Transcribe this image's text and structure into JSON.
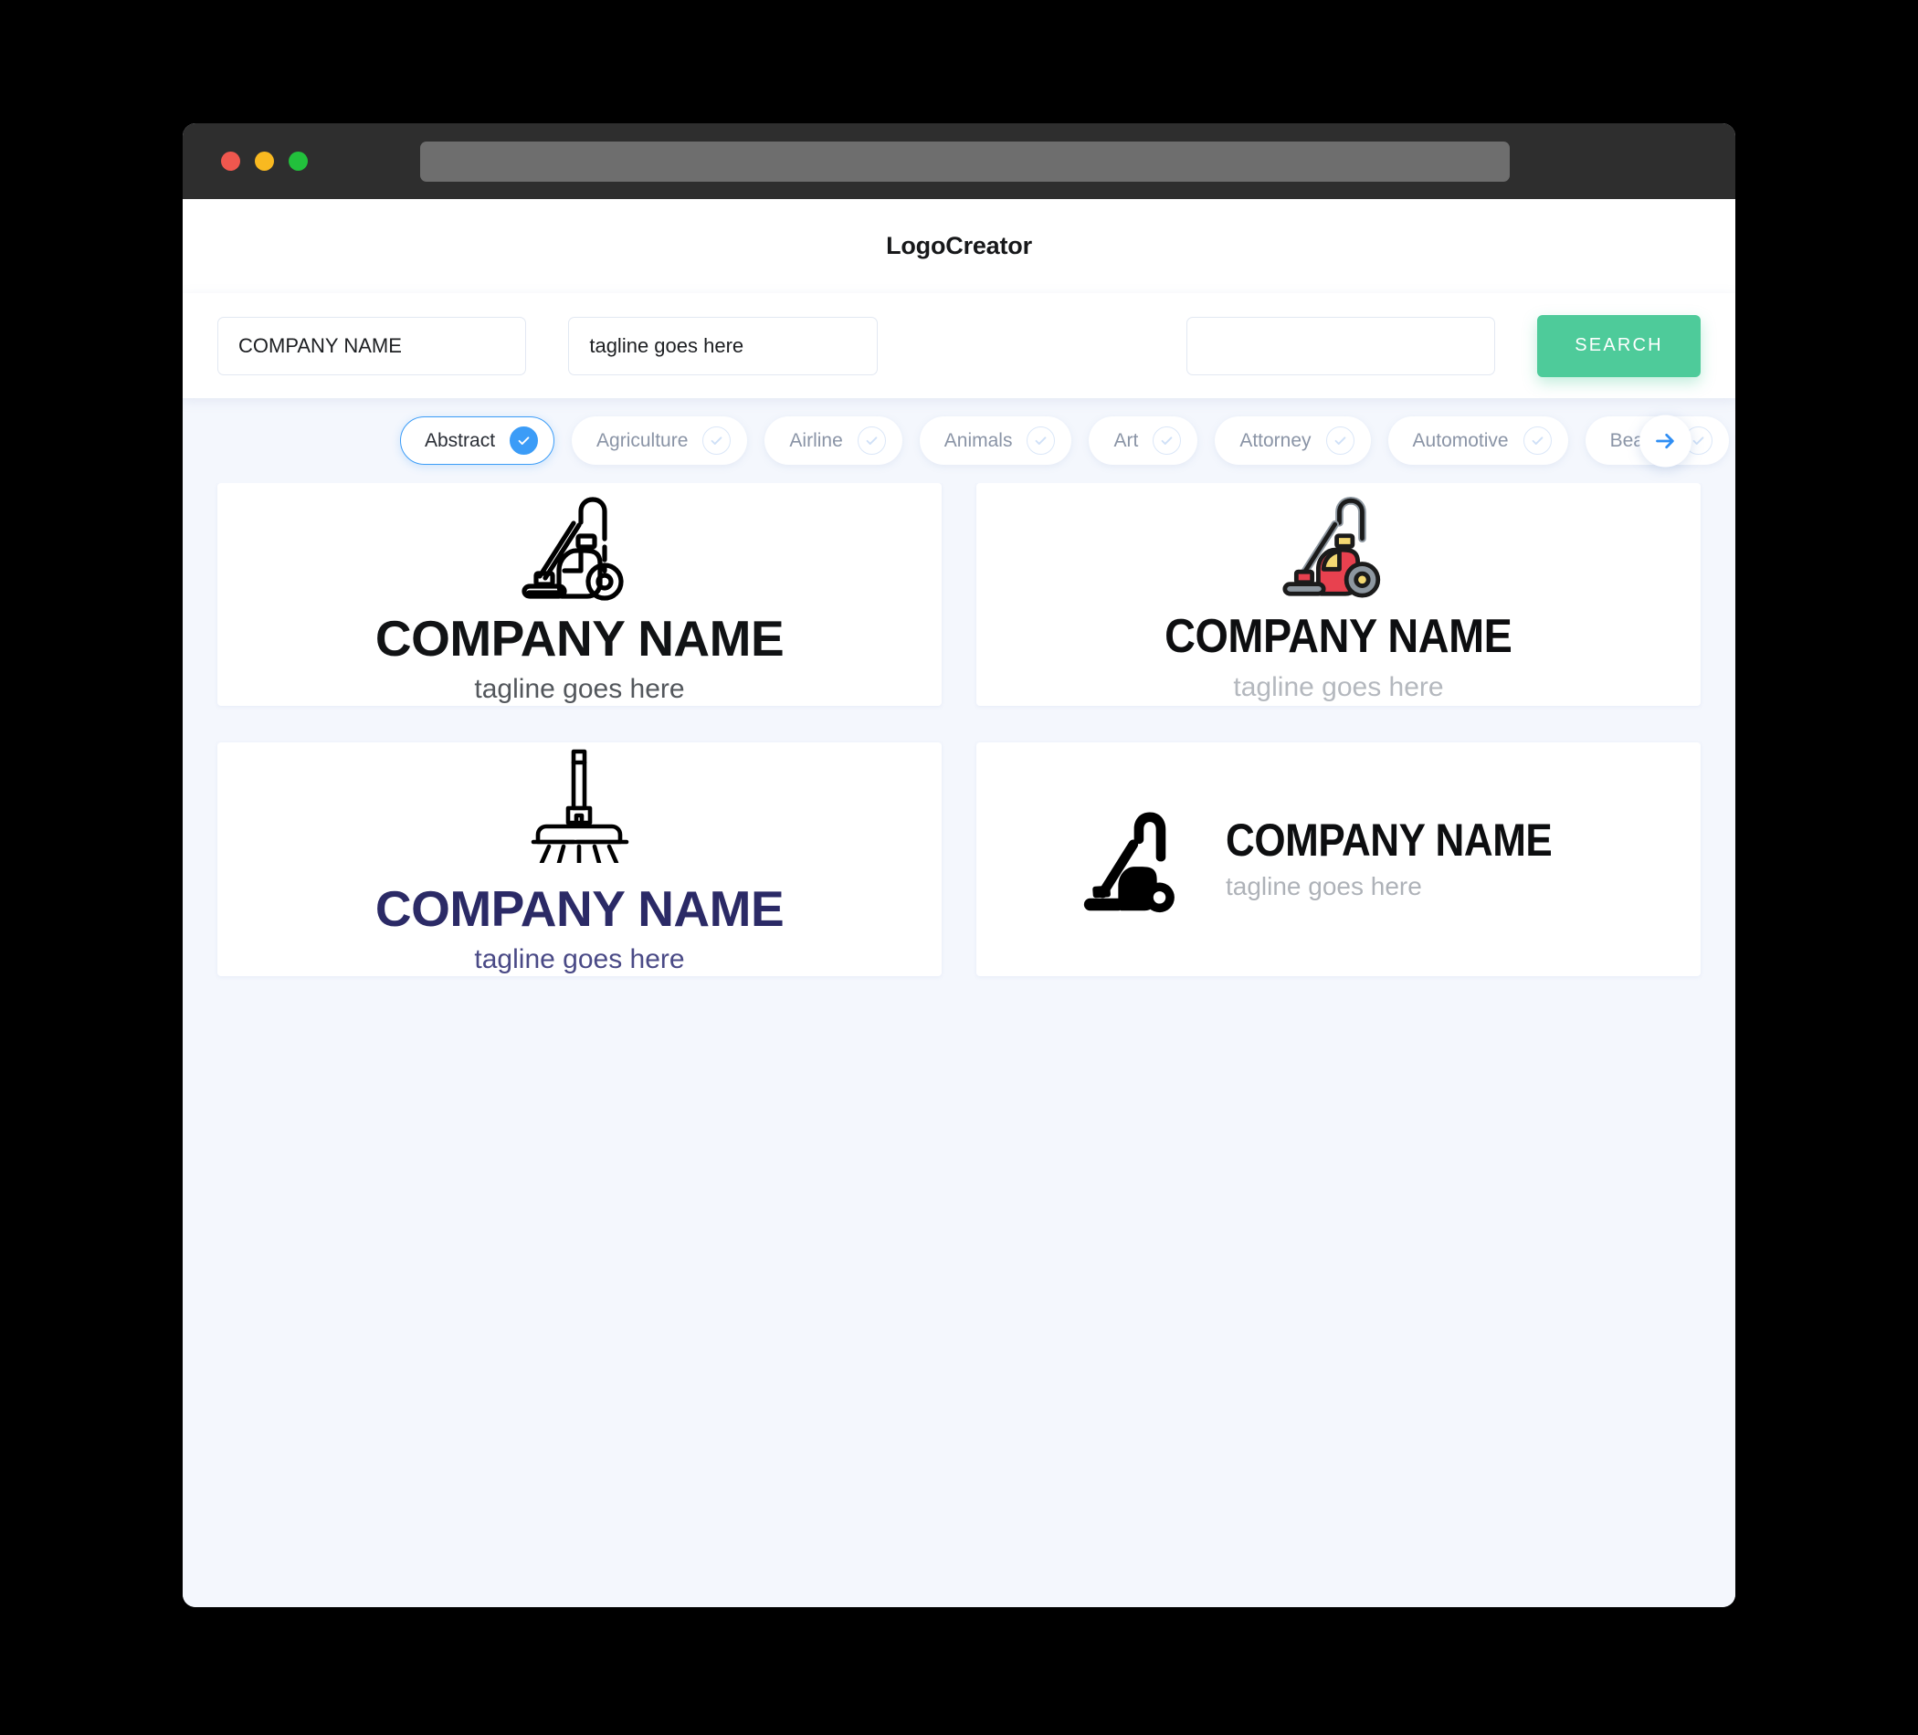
{
  "window": {
    "traffic_lights": [
      "close",
      "minimize",
      "maximize"
    ],
    "colors": {
      "close": "#f0574e",
      "minimize": "#f9b920",
      "maximize": "#22c03c",
      "titlebar": "#2e2e2e",
      "urlbar": "#6e6e6e"
    }
  },
  "header": {
    "title": "LogoCreator"
  },
  "search": {
    "company_value": "COMPANY NAME",
    "company_placeholder": "COMPANY NAME",
    "tagline_value": "tagline goes here",
    "tagline_placeholder": "tagline goes here",
    "keyword_value": "",
    "keyword_placeholder": "",
    "button_label": "SEARCH",
    "button_color": "#4ecb9a"
  },
  "categories": {
    "accent_color": "#3b9cf7",
    "next_icon": "arrow-right-icon",
    "items": [
      {
        "label": "Abstract",
        "selected": true
      },
      {
        "label": "Agriculture",
        "selected": false
      },
      {
        "label": "Airline",
        "selected": false
      },
      {
        "label": "Animals",
        "selected": false
      },
      {
        "label": "Art",
        "selected": false
      },
      {
        "label": "Attorney",
        "selected": false
      },
      {
        "label": "Automotive",
        "selected": false
      },
      {
        "label": "Beauty",
        "selected": false
      }
    ]
  },
  "results": [
    {
      "icon": "vacuum-cleaner-outline-icon",
      "name": "COMPANY NAME",
      "tagline": "tagline goes here",
      "name_color": "#111315",
      "tagline_color": "#53575c",
      "layout": "stacked"
    },
    {
      "icon": "vacuum-cleaner-color-icon",
      "name": "COMPANY NAME",
      "tagline": "tagline goes here",
      "name_color": "#0d0e10",
      "tagline_color": "#b4b8be",
      "layout": "stacked",
      "icon_colors": {
        "body": "#e8414f",
        "accent": "#f3d872",
        "metal": "#8d97a0",
        "outline": "#1b1b1b"
      }
    },
    {
      "icon": "broom-outline-icon",
      "name": "COMPANY NAME",
      "tagline": "tagline goes here",
      "name_color": "#2b2a66",
      "tagline_color": "#4a4a86",
      "layout": "stacked"
    },
    {
      "icon": "vacuum-cleaner-solid-icon",
      "name": "COMPANY NAME",
      "tagline": "tagline goes here",
      "name_color": "#0d0e10",
      "tagline_color": "#aeb2b8",
      "layout": "horizontal"
    }
  ]
}
